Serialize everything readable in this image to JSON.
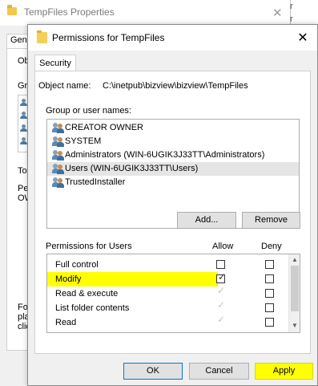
{
  "background_window": {
    "title": "TempFiles Properties",
    "close_glyph": "✕",
    "tab_fragment": "Gen",
    "fragments": [
      "Obj",
      "Gro",
      "To",
      "Pern",
      "OW",
      "Fo",
      "pla",
      "clic"
    ]
  },
  "edge_fragments": [
    "r",
    "r"
  ],
  "dialog": {
    "title": "Permissions for TempFiles",
    "close_glyph": "✕",
    "tab_security": "Security",
    "object_name_label": "Object name:",
    "object_name_value": "C:\\inetpub\\bizview\\bizview\\TempFiles",
    "group_label": "Group or user names:",
    "users": [
      {
        "name": "CREATOR OWNER",
        "selected": false
      },
      {
        "name": "SYSTEM",
        "selected": false
      },
      {
        "name": "Administrators (WIN-6UGIK3J33TT\\Administrators)",
        "selected": false
      },
      {
        "name": "Users (WIN-6UGIK3J33TT\\Users)",
        "selected": true
      },
      {
        "name": "TrustedInstaller",
        "selected": false
      }
    ],
    "add_button": "Add...",
    "remove_button": "Remove",
    "permissions_label": "Permissions for Users",
    "allow_header": "Allow",
    "deny_header": "Deny",
    "permissions": [
      {
        "name": "Full control",
        "allow": "unchecked",
        "deny": "unchecked"
      },
      {
        "name": "Modify",
        "allow": "checked",
        "deny": "unchecked",
        "highlight": true
      },
      {
        "name": "Read & execute",
        "allow": "checked-disabled",
        "deny": "unchecked"
      },
      {
        "name": "List folder contents",
        "allow": "checked-disabled",
        "deny": "unchecked"
      },
      {
        "name": "Read",
        "allow": "checked-disabled",
        "deny": "unchecked"
      }
    ],
    "ok_button": "OK",
    "cancel_button": "Cancel",
    "apply_button": "Apply",
    "highlight_color": "#ffff00"
  }
}
